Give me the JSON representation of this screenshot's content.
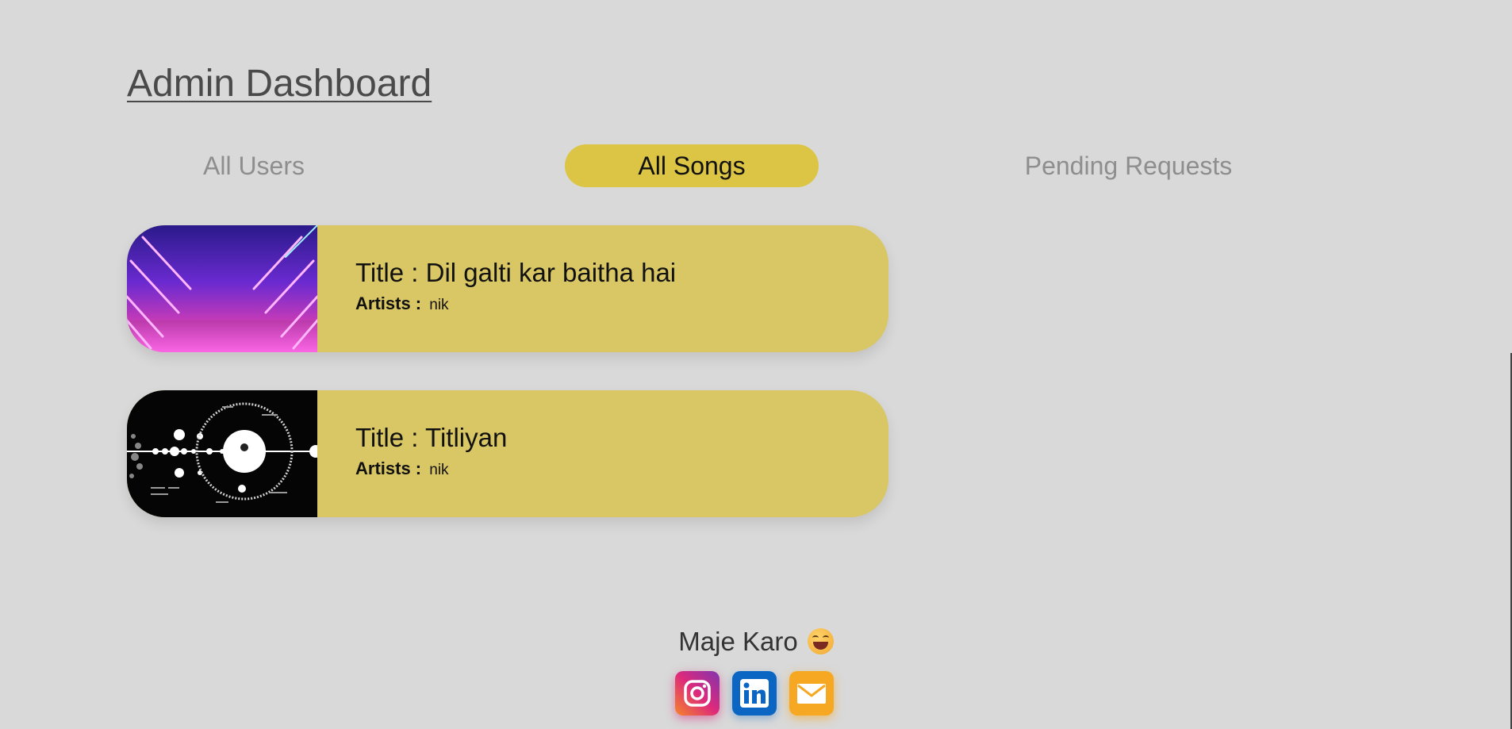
{
  "header": {
    "title": "Admin Dashboard"
  },
  "tabs": [
    {
      "label": "All Users",
      "active": false
    },
    {
      "label": "All Songs",
      "active": true
    },
    {
      "label": "Pending Requests",
      "active": false
    }
  ],
  "songs": [
    {
      "title_prefix": "Title : ",
      "title": "Dil galti kar baitha hai",
      "artists_label": "Artists :",
      "artists": "nik",
      "thumbnail": "neon-lights-image"
    },
    {
      "title_prefix": "Title : ",
      "title": "Titliyan",
      "artists_label": "Artists :",
      "artists": "nik",
      "thumbnail": "planetary-orbits-image"
    }
  ],
  "footer": {
    "text": "Maje Karo",
    "emoji": "grinning-face-icon",
    "social": [
      {
        "name": "instagram-icon"
      },
      {
        "name": "linkedin-icon"
      },
      {
        "name": "mail-icon"
      }
    ]
  },
  "colors": {
    "background": "#d9d9d9",
    "accent": "#dcc544",
    "card": "#d9c664",
    "tab_inactive": "#8e8e8e"
  }
}
